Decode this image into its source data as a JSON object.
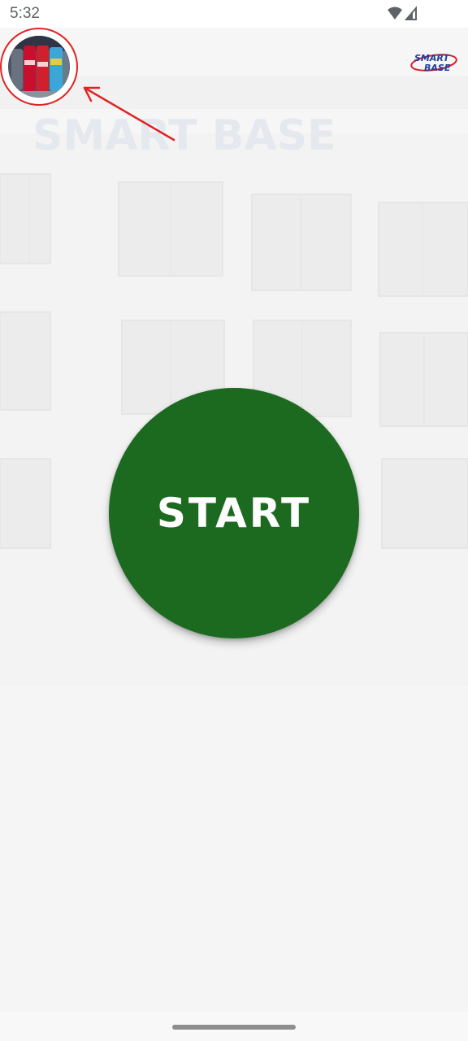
{
  "status_bar": {
    "time": "5:32",
    "icons": [
      "wifi-icon",
      "cellular-signal-icon"
    ]
  },
  "header": {
    "thumbnail_icon": "product-thumbnail",
    "logo_text_top": "SMART",
    "logo_text_bottom": "BASE"
  },
  "background": {
    "building_sign": "SMART BASE"
  },
  "main": {
    "start_label": "START"
  },
  "colors": {
    "start_button": "#1b6a1f",
    "annotation": "#e02424",
    "logo_blue": "#1d3f9e",
    "logo_red": "#d81e28"
  }
}
